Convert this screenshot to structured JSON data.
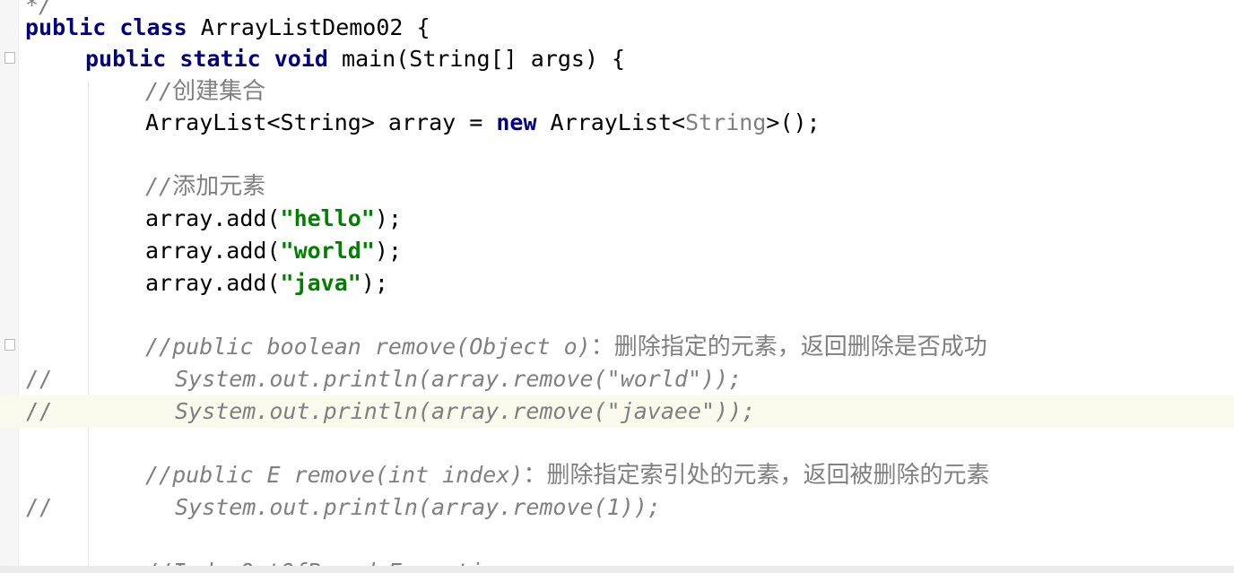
{
  "editor": {
    "lines": [
      {
        "tokens": [
          {
            "t": "*/",
            "c": "cm"
          }
        ]
      },
      {
        "tokens": [
          {
            "t": "public",
            "c": "kw"
          },
          {
            "t": " "
          },
          {
            "t": "class",
            "c": "kw"
          },
          {
            "t": " ArrayListDemo02 {"
          }
        ]
      },
      {
        "tokens": [
          {
            "t": "public",
            "c": "kw"
          },
          {
            "t": " "
          },
          {
            "t": "static",
            "c": "kw"
          },
          {
            "t": " "
          },
          {
            "t": "void",
            "c": "kw"
          },
          {
            "t": " main(String[] args) {"
          }
        ]
      },
      {
        "tokens": [
          {
            "t": "//",
            "c": "cm"
          },
          {
            "t": "创建集合",
            "c": "cn"
          }
        ]
      },
      {
        "tokens": [
          {
            "t": "ArrayList<String> array = "
          },
          {
            "t": "new",
            "c": "kw"
          },
          {
            "t": " ArrayList<"
          },
          {
            "t": "String",
            "c": "tp"
          },
          {
            "t": ">();"
          }
        ]
      },
      {
        "tokens": []
      },
      {
        "tokens": [
          {
            "t": "//",
            "c": "cm"
          },
          {
            "t": "添加元素",
            "c": "cn"
          }
        ]
      },
      {
        "tokens": [
          {
            "t": "array.add("
          },
          {
            "t": "\"hello\"",
            "c": "str"
          },
          {
            "t": ");"
          }
        ]
      },
      {
        "tokens": [
          {
            "t": "array.add("
          },
          {
            "t": "\"world\"",
            "c": "str"
          },
          {
            "t": ");"
          }
        ]
      },
      {
        "tokens": [
          {
            "t": "array.add("
          },
          {
            "t": "\"java\"",
            "c": "str"
          },
          {
            "t": ");"
          }
        ]
      },
      {
        "tokens": []
      },
      {
        "tokens": [
          {
            "t": "//public boolean remove(Object o)",
            "c": "cm"
          },
          {
            "t": "：删除指定的元素，返回删除是否成功",
            "c": "cn"
          }
        ]
      },
      {
        "slash": "//",
        "tokens": [
          {
            "t": "System.out.println(array.remove(\"world\"));",
            "c": "cm"
          }
        ]
      },
      {
        "slash": "//",
        "current": true,
        "tokens": [
          {
            "t": "System.out.println(array.remove(\"javaee\"));",
            "c": "cm"
          }
        ]
      },
      {
        "tokens": []
      },
      {
        "tokens": [
          {
            "t": "//public E remove(int index)",
            "c": "cm"
          },
          {
            "t": "：删除指定索引处的元素，返回被删除的元素",
            "c": "cn"
          }
        ]
      },
      {
        "slash": "//",
        "tokens": [
          {
            "t": "System.out.println(array.remove(1));",
            "c": "cm"
          }
        ]
      },
      {
        "tokens": []
      },
      {
        "tokens": [
          {
            "t": "//IndexOutOfBoundsException",
            "c": "cm"
          }
        ]
      }
    ]
  }
}
